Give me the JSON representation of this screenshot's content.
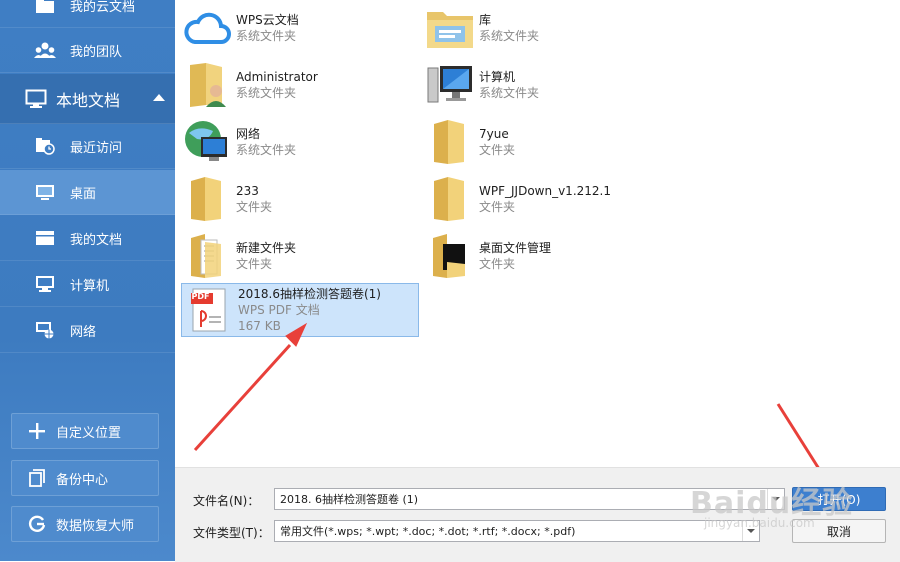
{
  "sidebar": {
    "top_items": [
      {
        "label": "我的云文档",
        "icon": "cloud-folder-icon"
      },
      {
        "label": "我的团队",
        "icon": "team-icon"
      }
    ],
    "section": {
      "label": "本地文档",
      "icon": "monitor-icon"
    },
    "local_items": [
      {
        "label": "最近访问",
        "icon": "recent-icon"
      },
      {
        "label": "桌面",
        "icon": "desktop-icon"
      },
      {
        "label": "我的文档",
        "icon": "documents-icon"
      },
      {
        "label": "计算机",
        "icon": "computer-icon"
      },
      {
        "label": "网络",
        "icon": "network-icon"
      }
    ],
    "buttons": [
      {
        "label": "自定义位置",
        "icon": "plus-icon"
      },
      {
        "label": "备份中心",
        "icon": "backup-icon"
      },
      {
        "label": "数据恢复大师",
        "icon": "recovery-icon"
      }
    ]
  },
  "files": [
    {
      "name": "WPS云文档",
      "type": "系统文件夹",
      "icon": "cloud-icon"
    },
    {
      "name": "库",
      "type": "系统文件夹",
      "icon": "library-folder-icon"
    },
    {
      "name": "Administrator",
      "type": "系统文件夹",
      "icon": "user-folder-icon"
    },
    {
      "name": "计算机",
      "type": "系统文件夹",
      "icon": "computer-icon"
    },
    {
      "name": "网络",
      "type": "系统文件夹",
      "icon": "network-globe-icon"
    },
    {
      "name": "7yue",
      "type": "文件夹",
      "icon": "folder-icon"
    },
    {
      "name": "233",
      "type": "文件夹",
      "icon": "folder-icon"
    },
    {
      "name": "WPF_JJDown_v1.212.1",
      "type": "文件夹",
      "icon": "folder-icon"
    },
    {
      "name": "新建文件夹",
      "type": "文件夹",
      "icon": "folder-with-docs-icon"
    },
    {
      "name": "桌面文件管理",
      "type": "文件夹",
      "icon": "folder-dark-icon"
    }
  ],
  "selected_file": {
    "name": "2018.6抽样检测答题卷(1)",
    "type": "WPS PDF 文档",
    "size": "167 KB",
    "icon": "pdf-icon",
    "badge": "PDF"
  },
  "bottom": {
    "filename_label": "文件名(N)：",
    "filename_value": "2018. 6抽样检测答题卷 (1)",
    "filetype_label": "文件类型(T)：",
    "filetype_value": "常用文件(*.wps; *.wpt; *.doc; *.dot; *.rtf; *.docx; *.pdf)",
    "open_label": "打开(O)",
    "cancel_label": "取消"
  },
  "watermark": {
    "line1": "Baidu经验",
    "line2": "jingyan.baidu.com"
  },
  "colors": {
    "sidebar": "#3f7ec4",
    "accent": "#e8403a",
    "selected": "#cde4fb"
  }
}
